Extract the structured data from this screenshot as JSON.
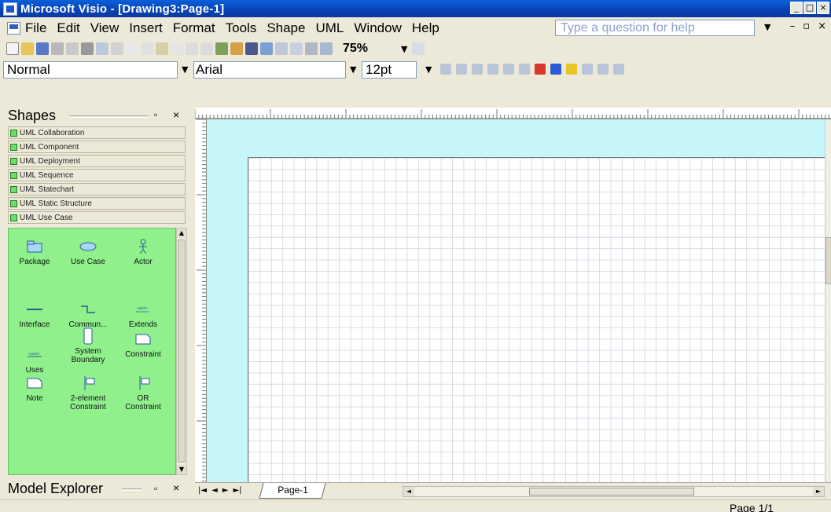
{
  "window": {
    "title": "Microsoft Visio - [Drawing3:Page-1]",
    "controls": [
      "_",
      "□",
      "×"
    ]
  },
  "menubar": {
    "items": [
      "File",
      "Edit",
      "View",
      "Insert",
      "Format",
      "Tools",
      "Shape",
      "UML",
      "Window",
      "Help"
    ],
    "help_placeholder": "Type a question for help"
  },
  "toolbar": {
    "zoom": "75%"
  },
  "format_toolbar": {
    "style": "Normal",
    "font": "Arial",
    "size": "12pt"
  },
  "shapes_panel": {
    "title": "Shapes",
    "stencils": [
      "UML Collaboration",
      "UML Component",
      "UML Deployment",
      "UML Sequence",
      "UML Statechart",
      "UML Static Structure",
      "UML Use Case"
    ],
    "items": [
      {
        "label": "Package",
        "icon": "folder-icon"
      },
      {
        "label": "Use Case",
        "icon": "ellipse-icon"
      },
      {
        "label": "Actor",
        "icon": "actor-icon"
      },
      {
        "label": "Interface",
        "icon": "interface-icon"
      },
      {
        "label": "Commun...",
        "icon": "communication-icon"
      },
      {
        "label": "Extends",
        "icon": "extends-icon"
      },
      {
        "label": "Uses",
        "icon": "uses-icon"
      },
      {
        "label": "System Boundary",
        "icon": "boundary-icon"
      },
      {
        "label": "Constraint",
        "icon": "constraint-icon"
      },
      {
        "label": "Note",
        "icon": "note-icon"
      },
      {
        "label": "2-element Constraint",
        "icon": "two-element-constraint-icon"
      },
      {
        "label": "OR Constraint",
        "icon": "or-constraint-icon"
      }
    ]
  },
  "model_explorer": {
    "title": "Model Explorer"
  },
  "page_tabs": {
    "active": "Page-1"
  },
  "status": {
    "page": "Page 1/1"
  },
  "colors": {
    "titlebar": "#0842b5",
    "canvas_bg": "#c6f6f7",
    "stencil_bg": "#8ff08c"
  }
}
